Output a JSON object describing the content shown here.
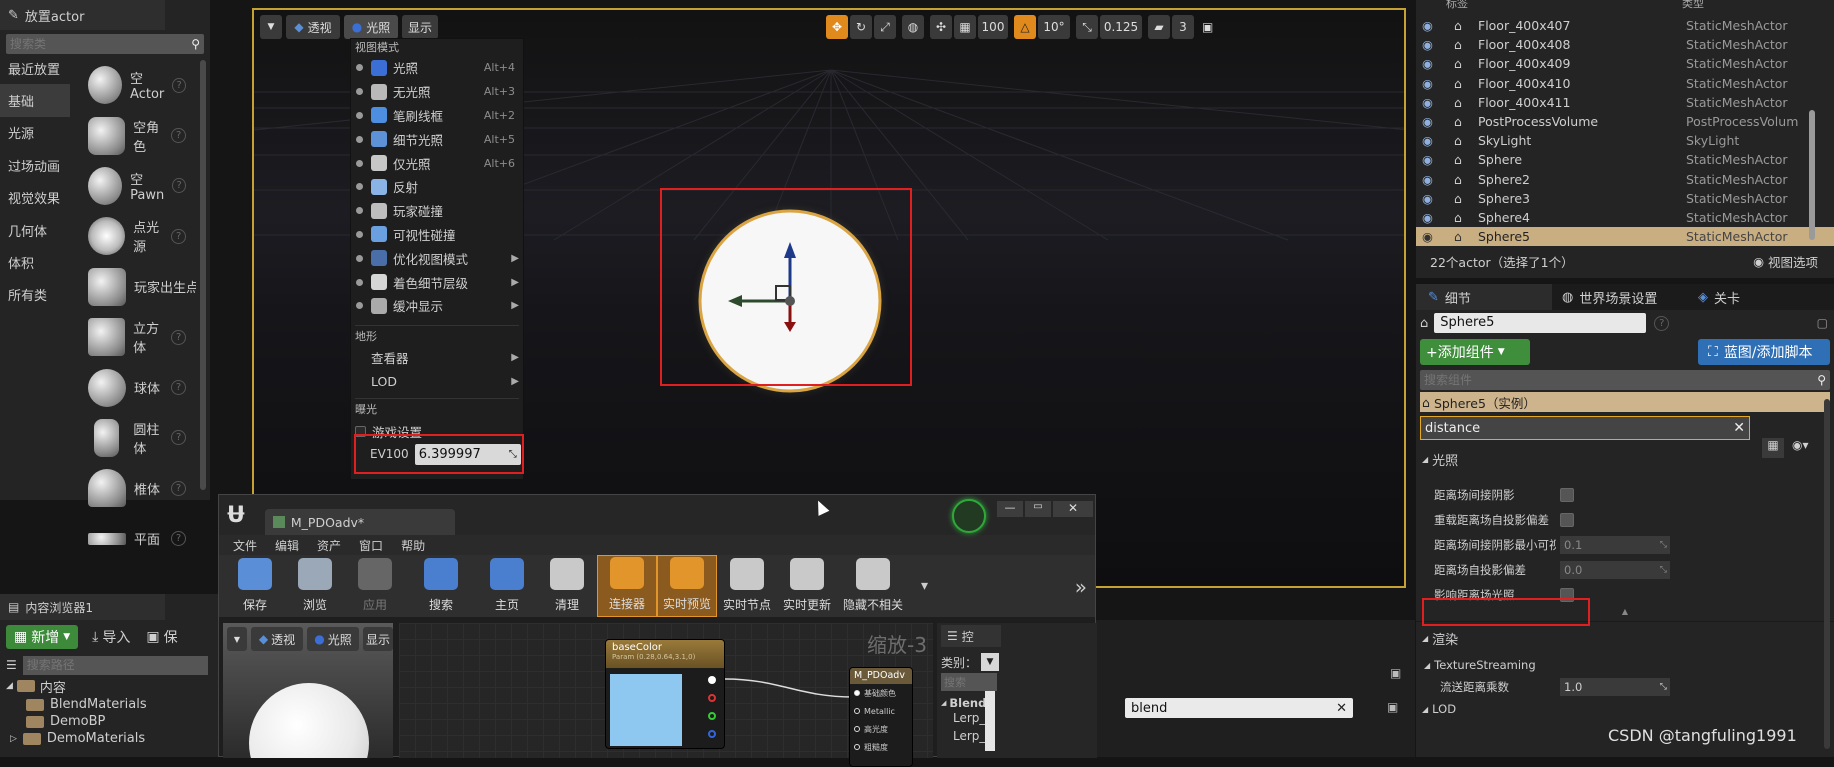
{
  "place_actor": {
    "title": "放置actor",
    "search_placeholder": "搜索类",
    "categories": [
      "最近放置",
      "基础",
      "光源",
      "过场动画",
      "视觉效果",
      "几何体",
      "体积",
      "所有类"
    ],
    "items": [
      "空Actor",
      "空角色",
      "空Pawn",
      "点光源",
      "玩家出生点",
      "立方体",
      "球体",
      "圆柱体",
      "椎体",
      "平面"
    ]
  },
  "viewport": {
    "view_btn": "透视",
    "lit_btn": "光照",
    "show_btn": "显示",
    "grid_value": "100",
    "angle_value": "10°",
    "scale_value": "0.125",
    "speed_value": "3"
  },
  "view_menu": {
    "section_view_mode": "视图模式",
    "modes": [
      {
        "label": "光照",
        "shortcut": "Alt+4",
        "color": "#3b6fd6",
        "has_sub": false
      },
      {
        "label": "无光照",
        "shortcut": "Alt+3",
        "color": "#b9b9b9",
        "has_sub": false
      },
      {
        "label": "笔刷线框",
        "shortcut": "Alt+2",
        "color": "#4d8ee0",
        "has_sub": false
      },
      {
        "label": "细节光照",
        "shortcut": "Alt+5",
        "color": "#5d92d6",
        "has_sub": false
      },
      {
        "label": "仅光照",
        "shortcut": "Alt+6",
        "color": "#c7c7c7",
        "has_sub": false
      },
      {
        "label": "反射",
        "shortcut": "",
        "color": "#8ab4e6",
        "has_sub": false
      },
      {
        "label": "玩家碰撞",
        "shortcut": "",
        "color": "#bdbdbd",
        "has_sub": false
      },
      {
        "label": "可视性碰撞",
        "shortcut": "",
        "color": "#6aa0e0",
        "has_sub": false
      },
      {
        "label": "优化视图模式",
        "shortcut": "",
        "color": "#4a6fa8",
        "has_sub": true
      },
      {
        "label": "着色细节层级",
        "shortcut": "",
        "color": "#d6d6d6",
        "has_sub": true
      },
      {
        "label": "缓冲显示",
        "shortcut": "",
        "color": "#aaaaaa",
        "has_sub": true
      }
    ],
    "section_landscape": "地形",
    "landscape_items": [
      {
        "label": "查看器",
        "has_sub": true
      },
      {
        "label": "LOD",
        "has_sub": true
      }
    ],
    "section_exposure": "曝光",
    "game_settings": "游戏设置",
    "ev100_label": "EV100",
    "ev100_value": "6.399997"
  },
  "outliner": {
    "header_label": "标签",
    "header_type": "类型",
    "rows": [
      {
        "name": "Floor_400x407",
        "type": "StaticMeshActor"
      },
      {
        "name": "Floor_400x408",
        "type": "StaticMeshActor"
      },
      {
        "name": "Floor_400x409",
        "type": "StaticMeshActor"
      },
      {
        "name": "Floor_400x410",
        "type": "StaticMeshActor"
      },
      {
        "name": "Floor_400x411",
        "type": "StaticMeshActor"
      },
      {
        "name": "PostProcessVolume",
        "type": "PostProcessVolum"
      },
      {
        "name": "SkyLight",
        "type": "SkyLight"
      },
      {
        "name": "Sphere",
        "type": "StaticMeshActor"
      },
      {
        "name": "Sphere2",
        "type": "StaticMeshActor"
      },
      {
        "name": "Sphere3",
        "type": "StaticMeshActor"
      },
      {
        "name": "Sphere4",
        "type": "StaticMeshActor"
      },
      {
        "name": "Sphere5",
        "type": "StaticMeshActor"
      }
    ],
    "count_text": "22个actor（选择了1个）",
    "view_options": "视图选项"
  },
  "details": {
    "tabs": [
      "细节",
      "世界场景设置",
      "关卡"
    ],
    "actor_name": "Sphere5",
    "add_component": "+添加组件",
    "blueprint_btn": "蓝图/添加脚本",
    "search_components_placeholder": "搜索组件",
    "instance_label": "Sphere5（实例）",
    "filter_value": "distance",
    "section_lighting": "光照",
    "props": [
      {
        "label": "距离场间接阴影",
        "kind": "check"
      },
      {
        "label": "重载距离场自投影偏差",
        "kind": "check"
      },
      {
        "label": "距离场间接阴影最小可视",
        "kind": "value",
        "value": "0.1"
      },
      {
        "label": "距离场自投影偏差",
        "kind": "value",
        "value": "0.0"
      },
      {
        "label": "影响距离场光照",
        "kind": "check"
      }
    ],
    "section_render": "渲染",
    "texture_streaming": "TextureStreaming",
    "stream_distance_label": "流送距离乘数",
    "stream_distance_value": "1.0",
    "section_lod": "LOD"
  },
  "content_browser": {
    "tab": "内容浏览器1",
    "new_btn": "新增",
    "import_btn": "导入",
    "save_btn": "保",
    "search_path_placeholder": "搜索路径",
    "root": "内容",
    "folders": [
      "BlendMaterials",
      "DemoBP",
      "DemoMaterials"
    ],
    "filter_value": "blend",
    "instance_text": "实例"
  },
  "material_editor": {
    "tab": "M_PDOadv*",
    "menus": [
      "文件",
      "编辑",
      "资产",
      "窗口",
      "帮助"
    ],
    "toolbar": [
      {
        "label": "保存",
        "color": "#5a8fd8",
        "active": false
      },
      {
        "label": "浏览",
        "color": "#9aa8b8",
        "active": false
      },
      {
        "label": "应用",
        "color": "#666666",
        "active": false
      },
      {
        "label": "搜索",
        "color": "#4a7fd0",
        "active": false
      },
      {
        "label": "主页",
        "color": "#4a7fd0",
        "active": false
      },
      {
        "label": "清理",
        "color": "#c9c9c9",
        "active": false
      },
      {
        "label": "连接器",
        "color": "#e2952a",
        "active": true
      },
      {
        "label": "实时预览",
        "color": "#e2952a",
        "active": true
      },
      {
        "label": "实时节点",
        "color": "#c9c9c9",
        "active": false
      },
      {
        "label": "实时更新",
        "color": "#c9c9c9",
        "active": false
      },
      {
        "label": "隐藏不相关",
        "color": "#c9c9c9",
        "active": false
      }
    ],
    "preview_view": "透视",
    "preview_lit": "光照",
    "preview_show": "显示",
    "zoom_text": "缩放-3",
    "node_title": "baseColor",
    "node_subtitle": "Param (0.28,0.64,3.1,0)",
    "output_title": "M_PDOadv",
    "output_pins": [
      "基础颜色",
      "Metallic",
      "高光度",
      "粗糙度"
    ],
    "palette_title": "控",
    "palette_category": "类别：",
    "palette_search_placeholder": "搜索",
    "palette_group": "Blends",
    "palette_items": [
      "Lerp_",
      "Lerp_"
    ]
  },
  "watermark": "CSDN @tangfuling1991"
}
